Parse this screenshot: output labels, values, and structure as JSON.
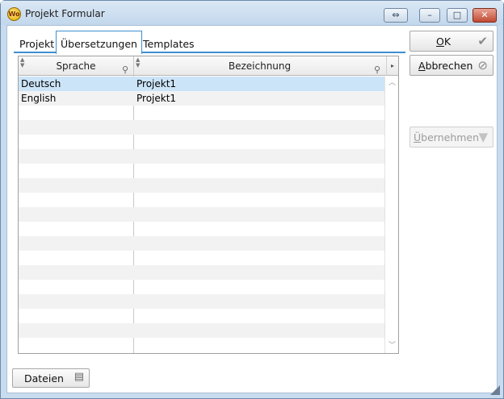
{
  "window": {
    "title": "Projekt Formular",
    "icon_text": "Wo"
  },
  "titlebar_buttons": {
    "restore": "⇔",
    "minimize": "–",
    "maximize": "□",
    "close": "✕"
  },
  "tabs": [
    {
      "label": "Projekt",
      "active": false
    },
    {
      "label": "Übersetzungen",
      "active": true
    },
    {
      "label": "Templates",
      "active": false
    }
  ],
  "grid": {
    "columns": [
      {
        "label": "Sprache"
      },
      {
        "label": "Bezeichnung"
      }
    ],
    "rows": [
      {
        "sprache": "Deutsch",
        "bezeichnung": "Projekt1",
        "selected": true
      },
      {
        "sprache": "English",
        "bezeichnung": "Projekt1",
        "selected": false
      }
    ],
    "empty_rows": 17
  },
  "buttons": {
    "ok": {
      "mnemonic": "O",
      "rest": "K",
      "icon": "checkmark-icon"
    },
    "cancel": {
      "mnemonic": "A",
      "rest": "bbrechen",
      "icon": "cancel-icon"
    },
    "apply": {
      "mnemonic": "Ü",
      "rest": "bernehmen",
      "icon": "triangle-down-icon",
      "disabled": true
    },
    "files": {
      "label": "Dateien",
      "icon": "files-icon"
    }
  },
  "colors": {
    "accent": "#3f8fd0",
    "selected_row": "#cce4f7",
    "titlebar": "#c9dcef"
  }
}
